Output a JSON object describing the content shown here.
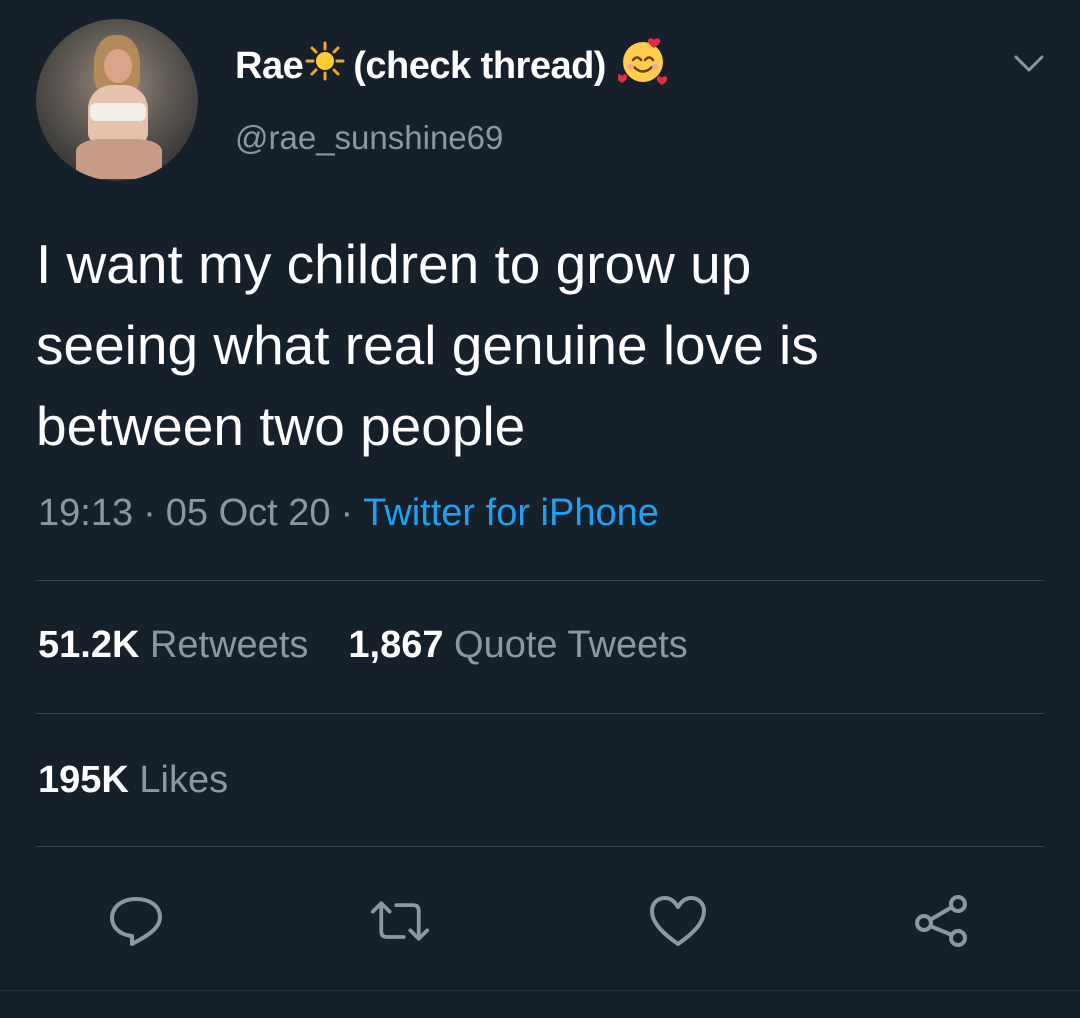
{
  "user": {
    "display_name_prefix": "Rae",
    "display_name_suffix": "(check thread)",
    "handle": "@rae_sunshine69",
    "avatar_icon": "profile-photo"
  },
  "tweet": {
    "text": "I want my children to grow up\nseeing what real genuine love is\nbetween two people",
    "time": "19:13",
    "date": "05 Oct 20",
    "separator": "·",
    "source": "Twitter for iPhone"
  },
  "stats": {
    "retweets_count": "51.2K",
    "retweets_label": "Retweets",
    "quotes_count": "1,867",
    "quotes_label": "Quote Tweets",
    "likes_count": "195K",
    "likes_label": "Likes"
  },
  "actions": [
    "reply-icon",
    "retweet-icon",
    "like-icon",
    "share-icon"
  ],
  "colors": {
    "background": "#15202b",
    "text": "#ffffff",
    "secondary": "#8899a6",
    "link": "#1da1f2",
    "divider": "#38444d"
  }
}
